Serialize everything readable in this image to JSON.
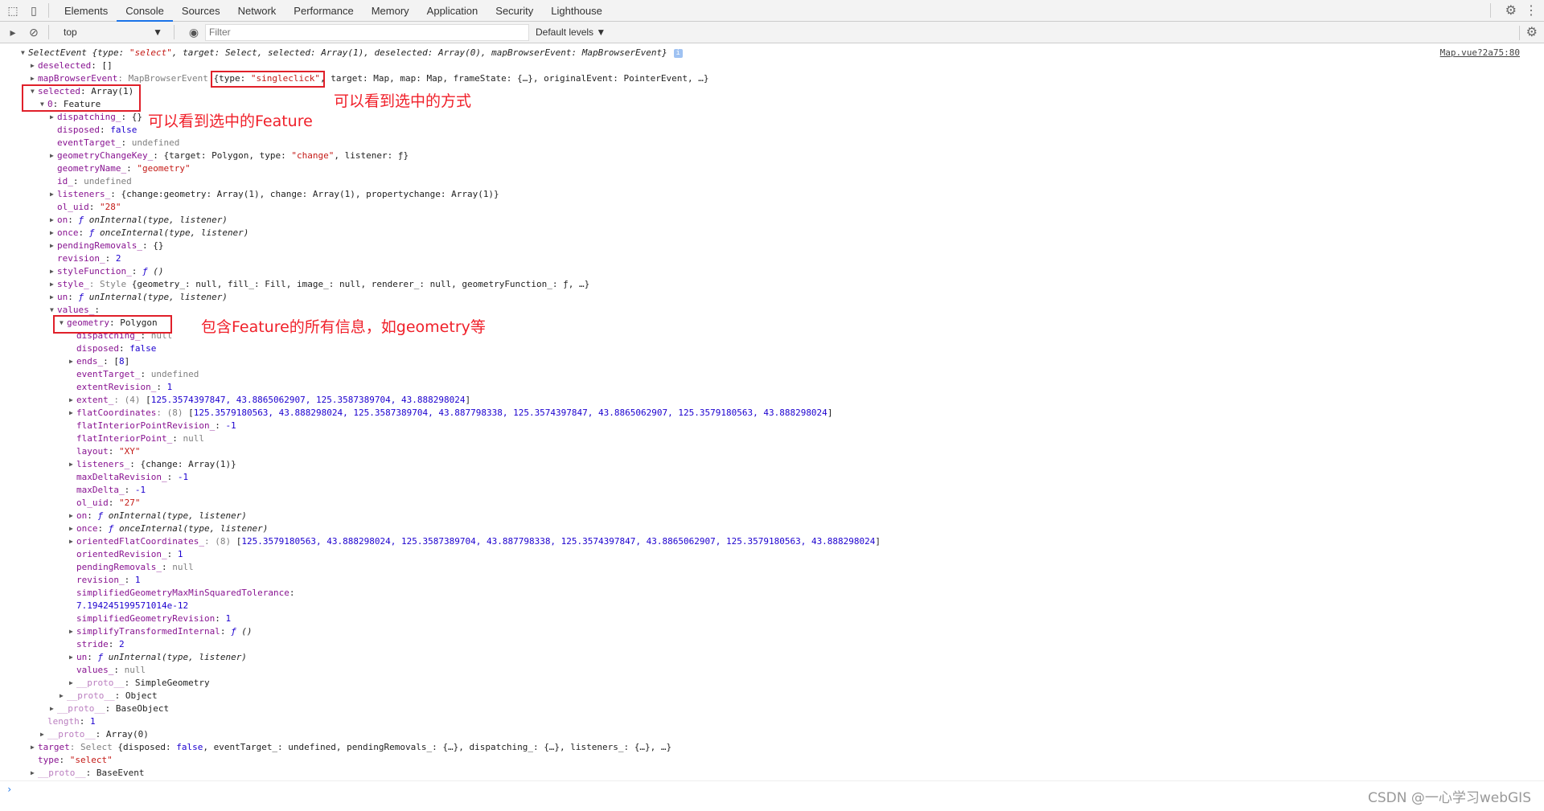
{
  "devtools": {
    "tabs": [
      "Elements",
      "Console",
      "Sources",
      "Network",
      "Performance",
      "Memory",
      "Application",
      "Security",
      "Lighthouse"
    ],
    "active_tab": "Console",
    "context": "top",
    "filter_placeholder": "Filter",
    "levels": "Default levels ▼",
    "accent": "#1a73e8"
  },
  "console": {
    "source_link": "Map.vue?2a75:80",
    "rows": [
      {
        "l": 0,
        "a": "o",
        "p": [
          [
            "SelectEvent {type: ",
            "i"
          ],
          [
            "\"select\"",
            "s i"
          ],
          [
            ", target: Select, selected: Array(1), deselected: Array(0), mapBrowserEvent: MapBrowserEvent}",
            "i"
          ]
        ]
      },
      {
        "l": 1,
        "a": "c",
        "p": [
          [
            "deselected",
            "k"
          ],
          [
            ": []",
            ""
          ]
        ]
      },
      {
        "l": 1,
        "a": "c",
        "p": [
          [
            "mapBrowserEvent",
            "k"
          ],
          [
            ": MapBrowserEvent ",
            "g"
          ],
          [
            "{type: ",
            ""
          ],
          [
            "\"singleclick\"",
            "s"
          ],
          [
            ", target: Map, map: Map, frameState: {…}, originalEvent: PointerEvent, …}",
            ""
          ]
        ]
      },
      {
        "l": 1,
        "a": "o",
        "p": [
          [
            "selected",
            "k"
          ],
          [
            ": Array(1)",
            ""
          ]
        ]
      },
      {
        "l": 2,
        "a": "o",
        "p": [
          [
            "0",
            "k"
          ],
          [
            ": Feature",
            ""
          ]
        ]
      },
      {
        "l": 3,
        "a": "c",
        "p": [
          [
            "dispatching_",
            "k"
          ],
          [
            ": {}",
            ""
          ]
        ]
      },
      {
        "l": 3,
        "a": "",
        "p": [
          [
            "disposed",
            "k"
          ],
          [
            ": ",
            ""
          ],
          [
            "false",
            "n"
          ]
        ]
      },
      {
        "l": 3,
        "a": "",
        "p": [
          [
            "eventTarget_",
            "k"
          ],
          [
            ": ",
            ""
          ],
          [
            "undefined",
            "g"
          ]
        ]
      },
      {
        "l": 3,
        "a": "c",
        "p": [
          [
            "geometryChangeKey_",
            "k"
          ],
          [
            ": {target: Polygon, type: ",
            ""
          ],
          [
            "\"change\"",
            "s"
          ],
          [
            ", listener: ƒ}",
            ""
          ]
        ]
      },
      {
        "l": 3,
        "a": "",
        "p": [
          [
            "geometryName_",
            "k"
          ],
          [
            ": ",
            ""
          ],
          [
            "\"geometry\"",
            "s"
          ]
        ]
      },
      {
        "l": 3,
        "a": "",
        "p": [
          [
            "id_",
            "k"
          ],
          [
            ": ",
            ""
          ],
          [
            "undefined",
            "g"
          ]
        ]
      },
      {
        "l": 3,
        "a": "c",
        "p": [
          [
            "listeners_",
            "k"
          ],
          [
            ": {change:geometry: Array(1), change: Array(1), propertychange: Array(1)}",
            ""
          ]
        ]
      },
      {
        "l": 3,
        "a": "",
        "p": [
          [
            "ol_uid",
            "k"
          ],
          [
            ": ",
            ""
          ],
          [
            "\"28\"",
            "s"
          ]
        ]
      },
      {
        "l": 3,
        "a": "c",
        "p": [
          [
            "on",
            "k"
          ],
          [
            ": ",
            ""
          ],
          [
            "ƒ",
            "n i"
          ],
          [
            " onInternal(type, listener)",
            "i"
          ]
        ]
      },
      {
        "l": 3,
        "a": "c",
        "p": [
          [
            "once",
            "k"
          ],
          [
            ": ",
            ""
          ],
          [
            "ƒ",
            "n i"
          ],
          [
            " onceInternal(type, listener)",
            "i"
          ]
        ]
      },
      {
        "l": 3,
        "a": "c",
        "p": [
          [
            "pendingRemovals_",
            "k"
          ],
          [
            ": {}",
            ""
          ]
        ]
      },
      {
        "l": 3,
        "a": "",
        "p": [
          [
            "revision_",
            "k"
          ],
          [
            ": ",
            ""
          ],
          [
            "2",
            "n"
          ]
        ]
      },
      {
        "l": 3,
        "a": "c",
        "p": [
          [
            "styleFunction_",
            "k"
          ],
          [
            ": ",
            ""
          ],
          [
            "ƒ",
            "n i"
          ],
          [
            " ()",
            "i"
          ]
        ]
      },
      {
        "l": 3,
        "a": "c",
        "p": [
          [
            "style_",
            "k"
          ],
          [
            ": Style ",
            "g"
          ],
          [
            "{geometry_: null, fill_: Fill, image_: null, renderer_: null, geometryFunction_: ƒ, …}",
            ""
          ]
        ]
      },
      {
        "l": 3,
        "a": "c",
        "p": [
          [
            "un",
            "k"
          ],
          [
            ": ",
            ""
          ],
          [
            "ƒ",
            "n i"
          ],
          [
            " unInternal(type, listener)",
            "i"
          ]
        ]
      },
      {
        "l": 3,
        "a": "o",
        "p": [
          [
            "values_",
            "k"
          ],
          [
            ":",
            ""
          ]
        ]
      },
      {
        "l": 4,
        "a": "o",
        "p": [
          [
            "geometry",
            "k"
          ],
          [
            ": Polygon",
            ""
          ]
        ]
      },
      {
        "l": 5,
        "a": "",
        "p": [
          [
            "dispatching_",
            "k"
          ],
          [
            ": ",
            ""
          ],
          [
            "null",
            "g"
          ]
        ]
      },
      {
        "l": 5,
        "a": "",
        "p": [
          [
            "disposed",
            "k"
          ],
          [
            ": ",
            ""
          ],
          [
            "false",
            "n"
          ]
        ]
      },
      {
        "l": 5,
        "a": "c",
        "p": [
          [
            "ends_",
            "k"
          ],
          [
            ": [",
            ""
          ],
          [
            "8",
            "n"
          ],
          [
            "]",
            ""
          ]
        ]
      },
      {
        "l": 5,
        "a": "",
        "p": [
          [
            "eventTarget_",
            "k"
          ],
          [
            ": ",
            ""
          ],
          [
            "undefined",
            "g"
          ]
        ]
      },
      {
        "l": 5,
        "a": "",
        "p": [
          [
            "extentRevision_",
            "k"
          ],
          [
            ": ",
            ""
          ],
          [
            "1",
            "n"
          ]
        ]
      },
      {
        "l": 5,
        "a": "c",
        "p": [
          [
            "extent_",
            "k"
          ],
          [
            ": (4) ",
            "g"
          ],
          [
            "[",
            ""
          ],
          [
            "125.3574397847, 43.8865062907, 125.3587389704, 43.888298024",
            "n"
          ],
          [
            "]",
            ""
          ]
        ]
      },
      {
        "l": 5,
        "a": "c",
        "p": [
          [
            "flatCoordinates",
            "k"
          ],
          [
            ": (8) ",
            "g"
          ],
          [
            "[",
            ""
          ],
          [
            "125.3579180563, 43.888298024, 125.3587389704, 43.887798338, 125.3574397847, 43.8865062907, 125.3579180563, 43.888298024",
            "n"
          ],
          [
            "]",
            ""
          ]
        ]
      },
      {
        "l": 5,
        "a": "",
        "p": [
          [
            "flatInteriorPointRevision_",
            "k"
          ],
          [
            ": ",
            ""
          ],
          [
            "-1",
            "n"
          ]
        ]
      },
      {
        "l": 5,
        "a": "",
        "p": [
          [
            "flatInteriorPoint_",
            "k"
          ],
          [
            ": ",
            ""
          ],
          [
            "null",
            "g"
          ]
        ]
      },
      {
        "l": 5,
        "a": "",
        "p": [
          [
            "layout",
            "k"
          ],
          [
            ": ",
            ""
          ],
          [
            "\"XY\"",
            "s"
          ]
        ]
      },
      {
        "l": 5,
        "a": "c",
        "p": [
          [
            "listeners_",
            "k"
          ],
          [
            ": {change: Array(1)}",
            ""
          ]
        ]
      },
      {
        "l": 5,
        "a": "",
        "p": [
          [
            "maxDeltaRevision_",
            "k"
          ],
          [
            ": ",
            ""
          ],
          [
            "-1",
            "n"
          ]
        ]
      },
      {
        "l": 5,
        "a": "",
        "p": [
          [
            "maxDelta_",
            "k"
          ],
          [
            ": ",
            ""
          ],
          [
            "-1",
            "n"
          ]
        ]
      },
      {
        "l": 5,
        "a": "",
        "p": [
          [
            "ol_uid",
            "k"
          ],
          [
            ": ",
            ""
          ],
          [
            "\"27\"",
            "s"
          ]
        ]
      },
      {
        "l": 5,
        "a": "c",
        "p": [
          [
            "on",
            "k"
          ],
          [
            ": ",
            ""
          ],
          [
            "ƒ",
            "n i"
          ],
          [
            " onInternal(type, listener)",
            "i"
          ]
        ]
      },
      {
        "l": 5,
        "a": "c",
        "p": [
          [
            "once",
            "k"
          ],
          [
            ": ",
            ""
          ],
          [
            "ƒ",
            "n i"
          ],
          [
            " onceInternal(type, listener)",
            "i"
          ]
        ]
      },
      {
        "l": 5,
        "a": "c",
        "p": [
          [
            "orientedFlatCoordinates_",
            "k"
          ],
          [
            ": (8) ",
            "g"
          ],
          [
            "[",
            ""
          ],
          [
            "125.3579180563, 43.888298024, 125.3587389704, 43.887798338, 125.3574397847, 43.8865062907, 125.3579180563, 43.888298024",
            "n"
          ],
          [
            "]",
            ""
          ]
        ]
      },
      {
        "l": 5,
        "a": "",
        "p": [
          [
            "orientedRevision_",
            "k"
          ],
          [
            ": ",
            ""
          ],
          [
            "1",
            "n"
          ]
        ]
      },
      {
        "l": 5,
        "a": "",
        "p": [
          [
            "pendingRemovals_",
            "k"
          ],
          [
            ": ",
            ""
          ],
          [
            "null",
            "g"
          ]
        ]
      },
      {
        "l": 5,
        "a": "",
        "p": [
          [
            "revision_",
            "k"
          ],
          [
            ": ",
            ""
          ],
          [
            "1",
            "n"
          ]
        ]
      },
      {
        "l": 5,
        "a": "",
        "p": [
          [
            "simplifiedGeometryMaxMinSquaredTolerance",
            "k"
          ],
          [
            ":",
            ""
          ]
        ]
      },
      {
        "l": 5,
        "a": "",
        "p": [
          [
            "7.194245199571014e-12",
            "n"
          ]
        ]
      },
      {
        "l": 5,
        "a": "",
        "p": [
          [
            "simplifiedGeometryRevision",
            "k"
          ],
          [
            ": ",
            ""
          ],
          [
            "1",
            "n"
          ]
        ]
      },
      {
        "l": 5,
        "a": "c",
        "p": [
          [
            "simplifyTransformedInternal",
            "k"
          ],
          [
            ": ",
            ""
          ],
          [
            "ƒ",
            "n i"
          ],
          [
            " ()",
            "i"
          ]
        ]
      },
      {
        "l": 5,
        "a": "",
        "p": [
          [
            "stride",
            "k"
          ],
          [
            ": ",
            ""
          ],
          [
            "2",
            "n"
          ]
        ]
      },
      {
        "l": 5,
        "a": "c",
        "p": [
          [
            "un",
            "k"
          ],
          [
            ": ",
            ""
          ],
          [
            "ƒ",
            "n i"
          ],
          [
            " unInternal(type, listener)",
            "i"
          ]
        ]
      },
      {
        "l": 5,
        "a": "",
        "p": [
          [
            "values_",
            "k"
          ],
          [
            ": ",
            ""
          ],
          [
            "null",
            "g"
          ]
        ]
      },
      {
        "l": 5,
        "a": "c",
        "p": [
          [
            "__proto__",
            "dk"
          ],
          [
            ": SimpleGeometry",
            ""
          ]
        ]
      },
      {
        "l": 4,
        "a": "c",
        "p": [
          [
            "__proto__",
            "dk"
          ],
          [
            ": Object",
            ""
          ]
        ]
      },
      {
        "l": 3,
        "a": "c",
        "p": [
          [
            "__proto__",
            "dk"
          ],
          [
            ": BaseObject",
            ""
          ]
        ]
      },
      {
        "l": 2,
        "a": "",
        "p": [
          [
            "length",
            "dk"
          ],
          [
            ": ",
            ""
          ],
          [
            "1",
            "n"
          ]
        ]
      },
      {
        "l": 2,
        "a": "c",
        "p": [
          [
            "__proto__",
            "dk"
          ],
          [
            ": Array(0)",
            ""
          ]
        ]
      },
      {
        "l": 1,
        "a": "c",
        "p": [
          [
            "target",
            "k"
          ],
          [
            ": Select ",
            "g"
          ],
          [
            "{disposed: ",
            ""
          ],
          [
            "false",
            "n"
          ],
          [
            ", eventTarget_: undefined, pendingRemovals_: {…}, dispatching_: {…}, listeners_: {…}, …}",
            ""
          ]
        ]
      },
      {
        "l": 1,
        "a": "",
        "p": [
          [
            "type",
            "k"
          ],
          [
            ": ",
            ""
          ],
          [
            "\"select\"",
            "s"
          ]
        ]
      },
      {
        "l": 1,
        "a": "c",
        "p": [
          [
            "__proto__",
            "dk"
          ],
          [
            ": BaseEvent",
            ""
          ]
        ]
      }
    ]
  },
  "annotations": {
    "note_click": "可以看到选中的方式",
    "note_feature": "可以看到选中的Feature",
    "note_geometry": "包含Feature的所有信息，如geometry等",
    "color": "#e0202a"
  },
  "watermark": "CSDN @一心学习webGIS"
}
